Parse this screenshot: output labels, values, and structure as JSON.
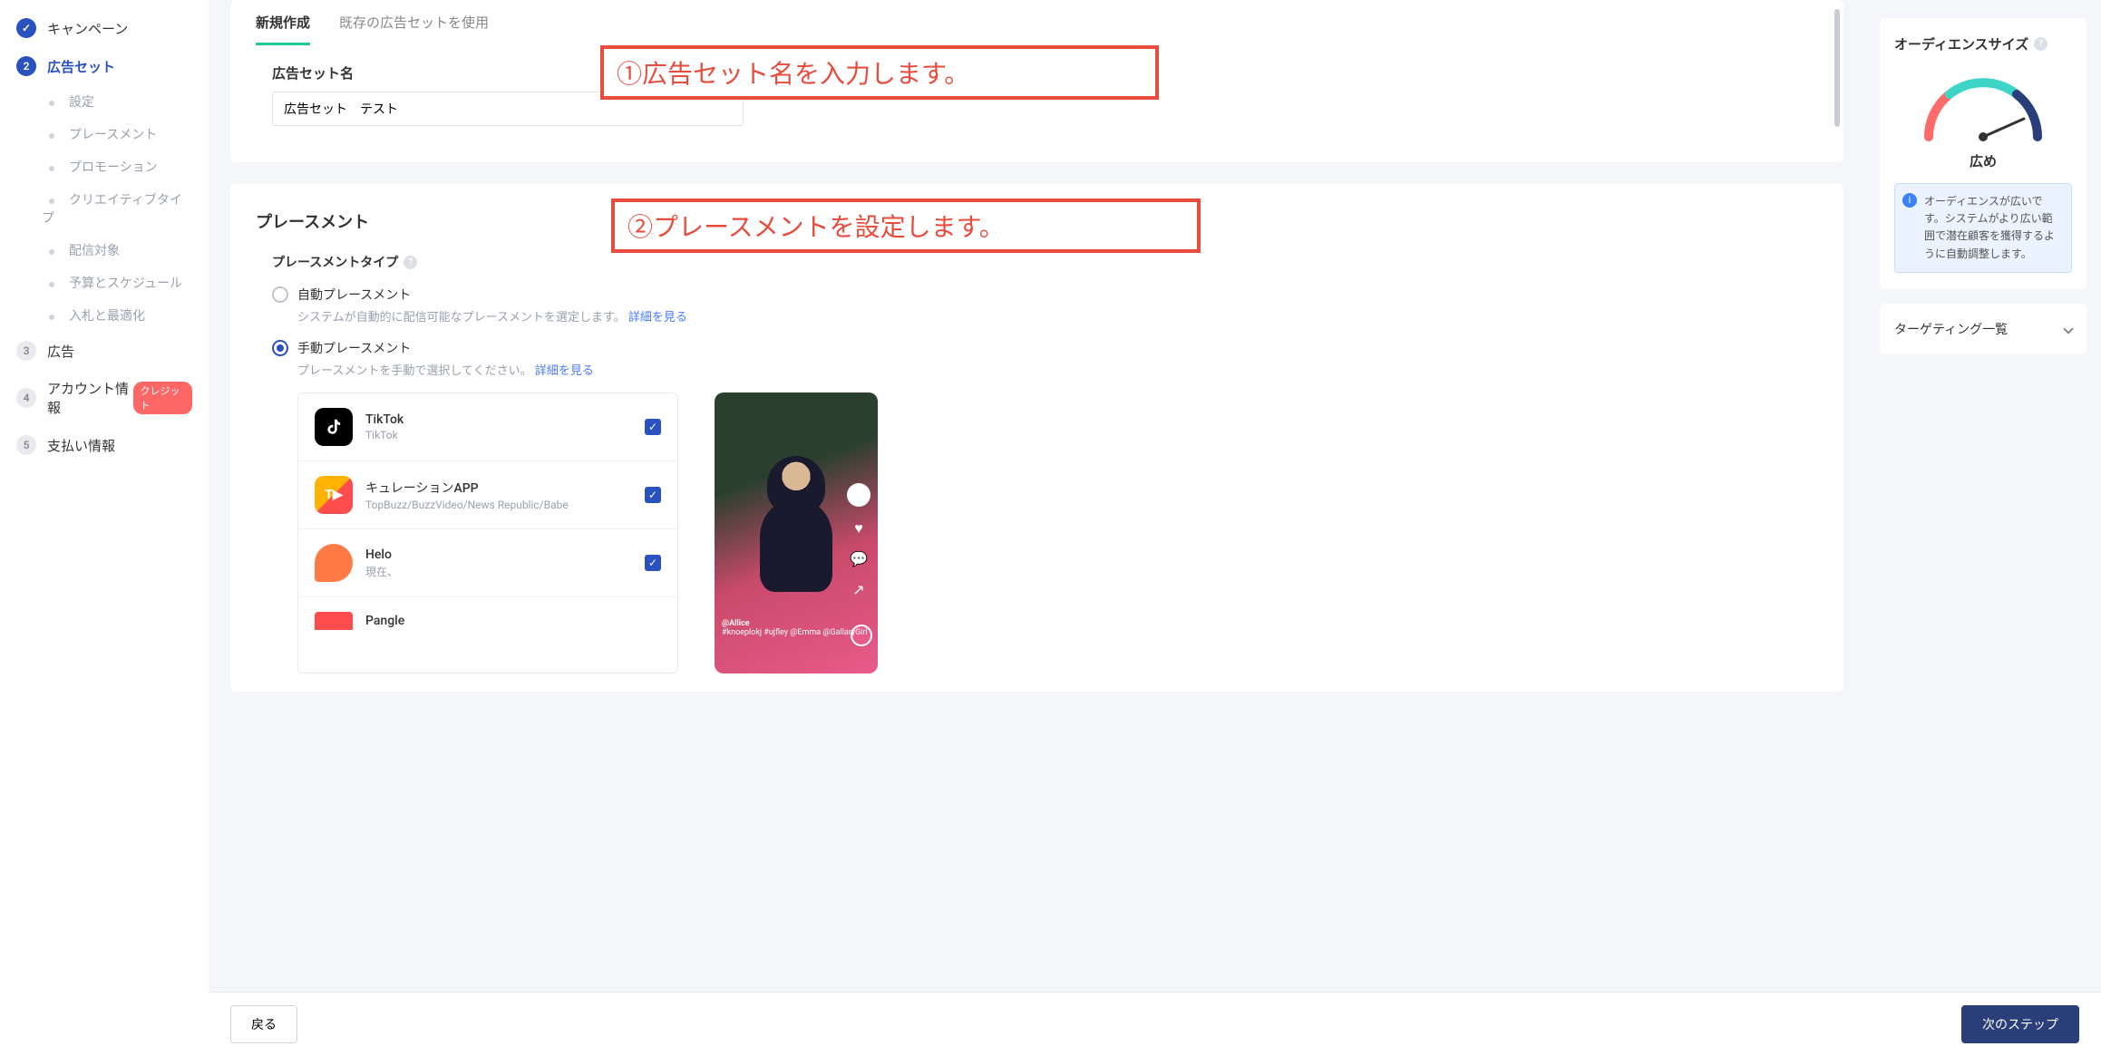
{
  "sidebar": {
    "campaign": "キャンペーン",
    "adset": "広告セット",
    "subs": [
      "設定",
      "プレースメント",
      "プロモーション",
      "クリエイティブタイプ",
      "配信対象",
      "予算とスケジュール",
      "入札と最適化"
    ],
    "ad": "広告",
    "account": "アカウント情報",
    "credit_badge": "クレジット",
    "payment": "支払い情報"
  },
  "tabs": {
    "new": "新規作成",
    "existing": "既存の広告セットを使用"
  },
  "form": {
    "adset_name_label": "広告セット名",
    "adset_name_value": "広告セット　テスト"
  },
  "annotations": {
    "a1": "①広告セット名を入力します。",
    "a2": "②プレースメントを設定します。"
  },
  "placement": {
    "title": "プレースメント",
    "type_label": "プレースメントタイプ",
    "auto_label": "自動プレースメント",
    "auto_desc": "システムが自動的に配信可能なプレースメントを選定します。",
    "manual_label": "手動プレースメント",
    "manual_desc": "プレースメントを手動で選択してください。",
    "detail_link": "詳細を見る",
    "apps": [
      {
        "name": "TikTok",
        "sub": "TikTok",
        "checked": true,
        "icon": "tiktok"
      },
      {
        "name": "キュレーションAPP",
        "sub": "TopBuzz/BuzzVideo/News Republic/Babe",
        "checked": true,
        "icon": "curation"
      },
      {
        "name": "Helo",
        "sub": "現在、",
        "checked": true,
        "icon": "helo"
      },
      {
        "name": "Pangle",
        "sub": "",
        "checked": false,
        "icon": "pangle"
      }
    ],
    "preview_caption1": "@Allice",
    "preview_caption2": "#knoeplokj #ujfley @Emma @GallaryGirl"
  },
  "right": {
    "audience_title": "オーディエンスサイズ",
    "gauge_label": "広め",
    "info_text": "オーディエンスが広いです。システムがより広い範囲で潜在顧客を獲得するように自動調整します。",
    "targeting_title": "ターゲティング一覧"
  },
  "footer": {
    "back": "戻る",
    "next": "次のステップ"
  }
}
